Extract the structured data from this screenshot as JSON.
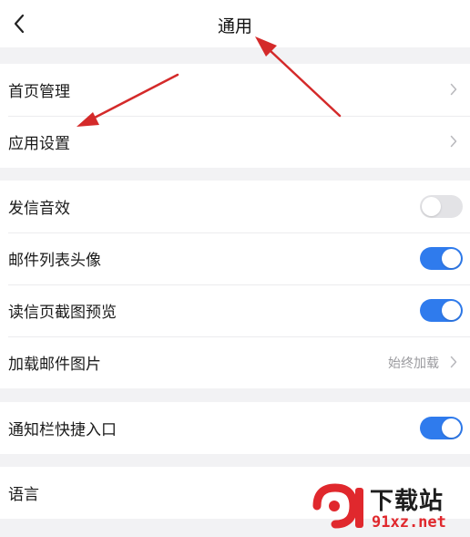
{
  "header": {
    "title": "通用",
    "back_icon": "chevron-left-icon"
  },
  "groups": [
    {
      "items": [
        {
          "label": "首页管理",
          "control": "chevron"
        },
        {
          "label": "应用设置",
          "control": "chevron"
        }
      ]
    },
    {
      "items": [
        {
          "label": "发信音效",
          "control": "toggle",
          "state": "off"
        },
        {
          "label": "邮件列表头像",
          "control": "toggle",
          "state": "on"
        },
        {
          "label": "读信页截图预览",
          "control": "toggle",
          "state": "on"
        },
        {
          "label": "加载邮件图片",
          "control": "chevron",
          "value": "始终加载"
        }
      ]
    },
    {
      "items": [
        {
          "label": "通知栏快捷入口",
          "control": "toggle",
          "state": "on"
        }
      ]
    },
    {
      "items": [
        {
          "label": "语言",
          "control": "none"
        }
      ]
    }
  ],
  "colors": {
    "toggle_on": "#2f7bed",
    "toggle_off": "#e3e3e6",
    "annotation_arrow": "#d42a2a"
  },
  "watermark": {
    "cn": "下载站",
    "url": "91xz.net",
    "logo": "91"
  }
}
